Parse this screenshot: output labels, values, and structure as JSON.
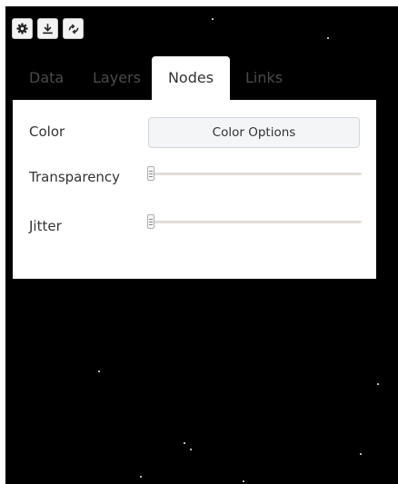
{
  "toolbar": {
    "buttons": [
      {
        "icon": "gear-icon"
      },
      {
        "icon": "download-icon"
      },
      {
        "icon": "refresh-icon"
      }
    ]
  },
  "tabs": [
    {
      "label": "Data",
      "active": false
    },
    {
      "label": "Layers",
      "active": false
    },
    {
      "label": "Nodes",
      "active": true
    },
    {
      "label": "Links",
      "active": false
    }
  ],
  "panel": {
    "color": {
      "label": "Color",
      "button_label": "Color Options"
    },
    "transparency": {
      "label": "Transparency",
      "value": 0
    },
    "jitter": {
      "label": "Jitter",
      "value": 0
    }
  },
  "colors": {
    "background": "#000000",
    "panel": "#ffffff",
    "active_tab_text": "#333333",
    "inactive_tab_text": "#4a4a4a",
    "slider_track": "#e2ddd8"
  }
}
